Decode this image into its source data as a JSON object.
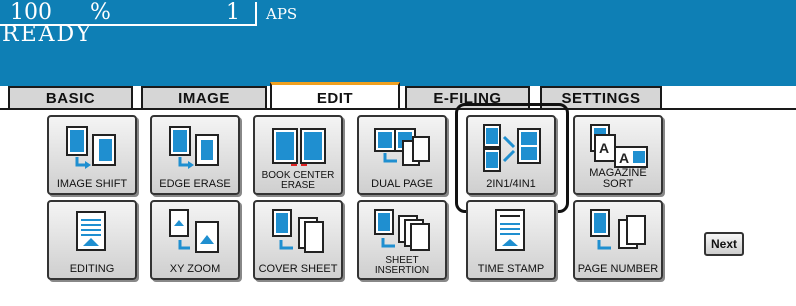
{
  "status": {
    "zoom_value": "100",
    "zoom_unit": "%",
    "copies": "1",
    "paper": "APS",
    "message": "READY"
  },
  "tabs": [
    "BASIC",
    "IMAGE",
    "EDIT",
    "E-FILING",
    "SETTINGS"
  ],
  "active_tab": "EDIT",
  "buttons_row1": [
    "IMAGE SHIFT",
    "EDGE ERASE",
    "BOOK CENTER ERASE",
    "DUAL PAGE",
    "2IN1/4IN1",
    "MAGAZINE SORT"
  ],
  "buttons_row2": [
    "EDITING",
    "XY ZOOM",
    "COVER SHEET",
    "SHEET INSERTION",
    "TIME STAMP",
    "PAGE NUMBER"
  ],
  "book_center_lines": [
    "BOOK CENTER",
    "ERASE"
  ],
  "sheet_insertion_lines": [
    "SHEET",
    "INSERTION"
  ],
  "next_label": "Next",
  "selected_button": "2IN1/4IN1",
  "colors": {
    "status_bg": "#0e7fb5",
    "accent": "#1f8fd0",
    "tab_active_top": "#f0a020"
  }
}
